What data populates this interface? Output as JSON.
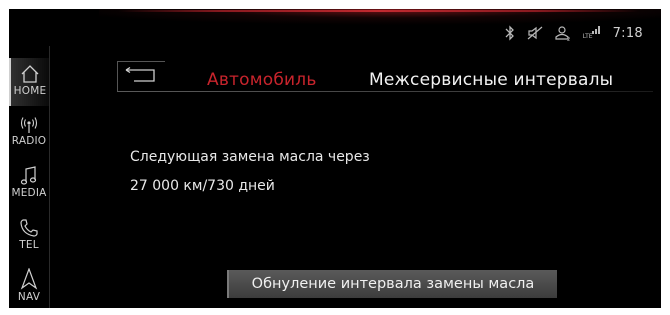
{
  "status": {
    "icons": [
      "bluetooth-icon",
      "mute-icon",
      "profile-icon",
      "lte-signal-icon"
    ],
    "lte_label": "LTE",
    "time": "7:18"
  },
  "nav": {
    "items": [
      {
        "label": "HOME",
        "icon": "home-icon",
        "active": true
      },
      {
        "label": "RADIO",
        "icon": "radio-icon",
        "active": false
      },
      {
        "label": "MEDIA",
        "icon": "music-note-icon",
        "active": false
      },
      {
        "label": "TEL",
        "icon": "phone-icon",
        "active": false
      },
      {
        "label": "NAV",
        "icon": "navigation-arrow-icon",
        "active": false
      }
    ]
  },
  "header": {
    "breadcrumb": "Автомобиль",
    "title": "Межсервисные интервалы"
  },
  "content": {
    "line1": "Следующая замена масла через",
    "line2": "27 000 км/730 дней"
  },
  "actions": {
    "reset_label": "Обнуление интервала замены масла"
  },
  "colors": {
    "accent": "#c8242c",
    "background": "#000000",
    "text": "#e8e8e8"
  }
}
